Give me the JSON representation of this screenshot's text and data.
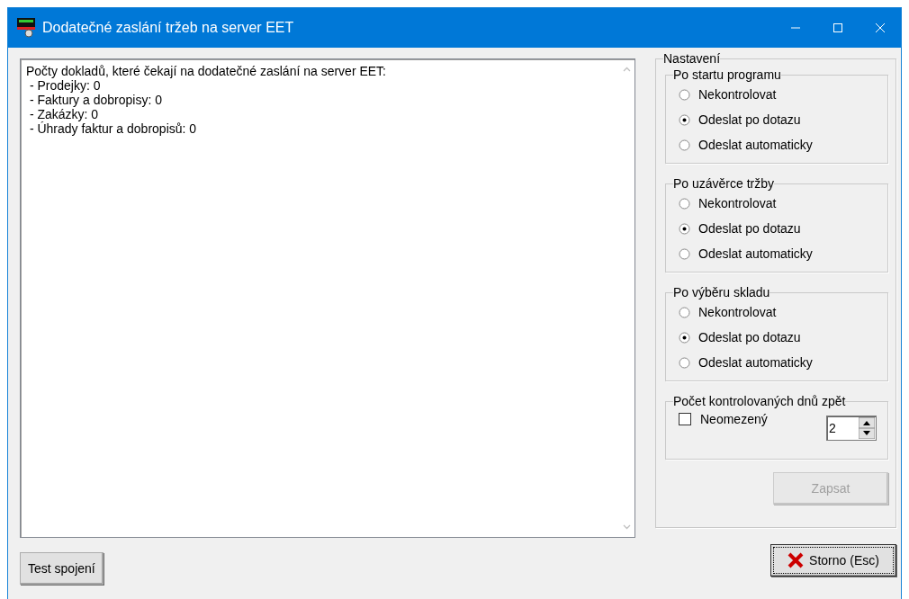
{
  "window": {
    "title": "Dodatečné zaslání tržeb na server EET"
  },
  "text_area": {
    "lines": [
      "Počty dokladů, které čekají na dodatečné zaslání na server EET:",
      " - Prodejky: 0",
      " - Faktury a dobropisy: 0",
      " - Zakázky: 0",
      " - Úhrady faktur a dobropisů: 0"
    ]
  },
  "settings": {
    "title": "Nastavení",
    "groups": [
      {
        "title": "Po startu programu",
        "options": [
          {
            "label": "Nekontrolovat",
            "selected": false
          },
          {
            "label": "Odeslat po dotazu",
            "selected": true
          },
          {
            "label": "Odeslat automaticky",
            "selected": false
          }
        ]
      },
      {
        "title": "Po uzávěrce tržby",
        "options": [
          {
            "label": "Nekontrolovat",
            "selected": false
          },
          {
            "label": "Odeslat po dotazu",
            "selected": true
          },
          {
            "label": "Odeslat automaticky",
            "selected": false
          }
        ]
      },
      {
        "title": "Po výběru skladu",
        "options": [
          {
            "label": "Nekontrolovat",
            "selected": false
          },
          {
            "label": "Odeslat po dotazu",
            "selected": true
          },
          {
            "label": "Odeslat automaticky",
            "selected": false
          }
        ]
      }
    ],
    "days": {
      "title": "Počet kontrolovaných dnů zpět",
      "unlimited": {
        "label": "Neomezený",
        "checked": false
      },
      "value": "2"
    },
    "save_button": {
      "label": "Zapsat",
      "disabled": true
    }
  },
  "buttons": {
    "test": "Test spojení",
    "cancel": "Storno (Esc)"
  }
}
